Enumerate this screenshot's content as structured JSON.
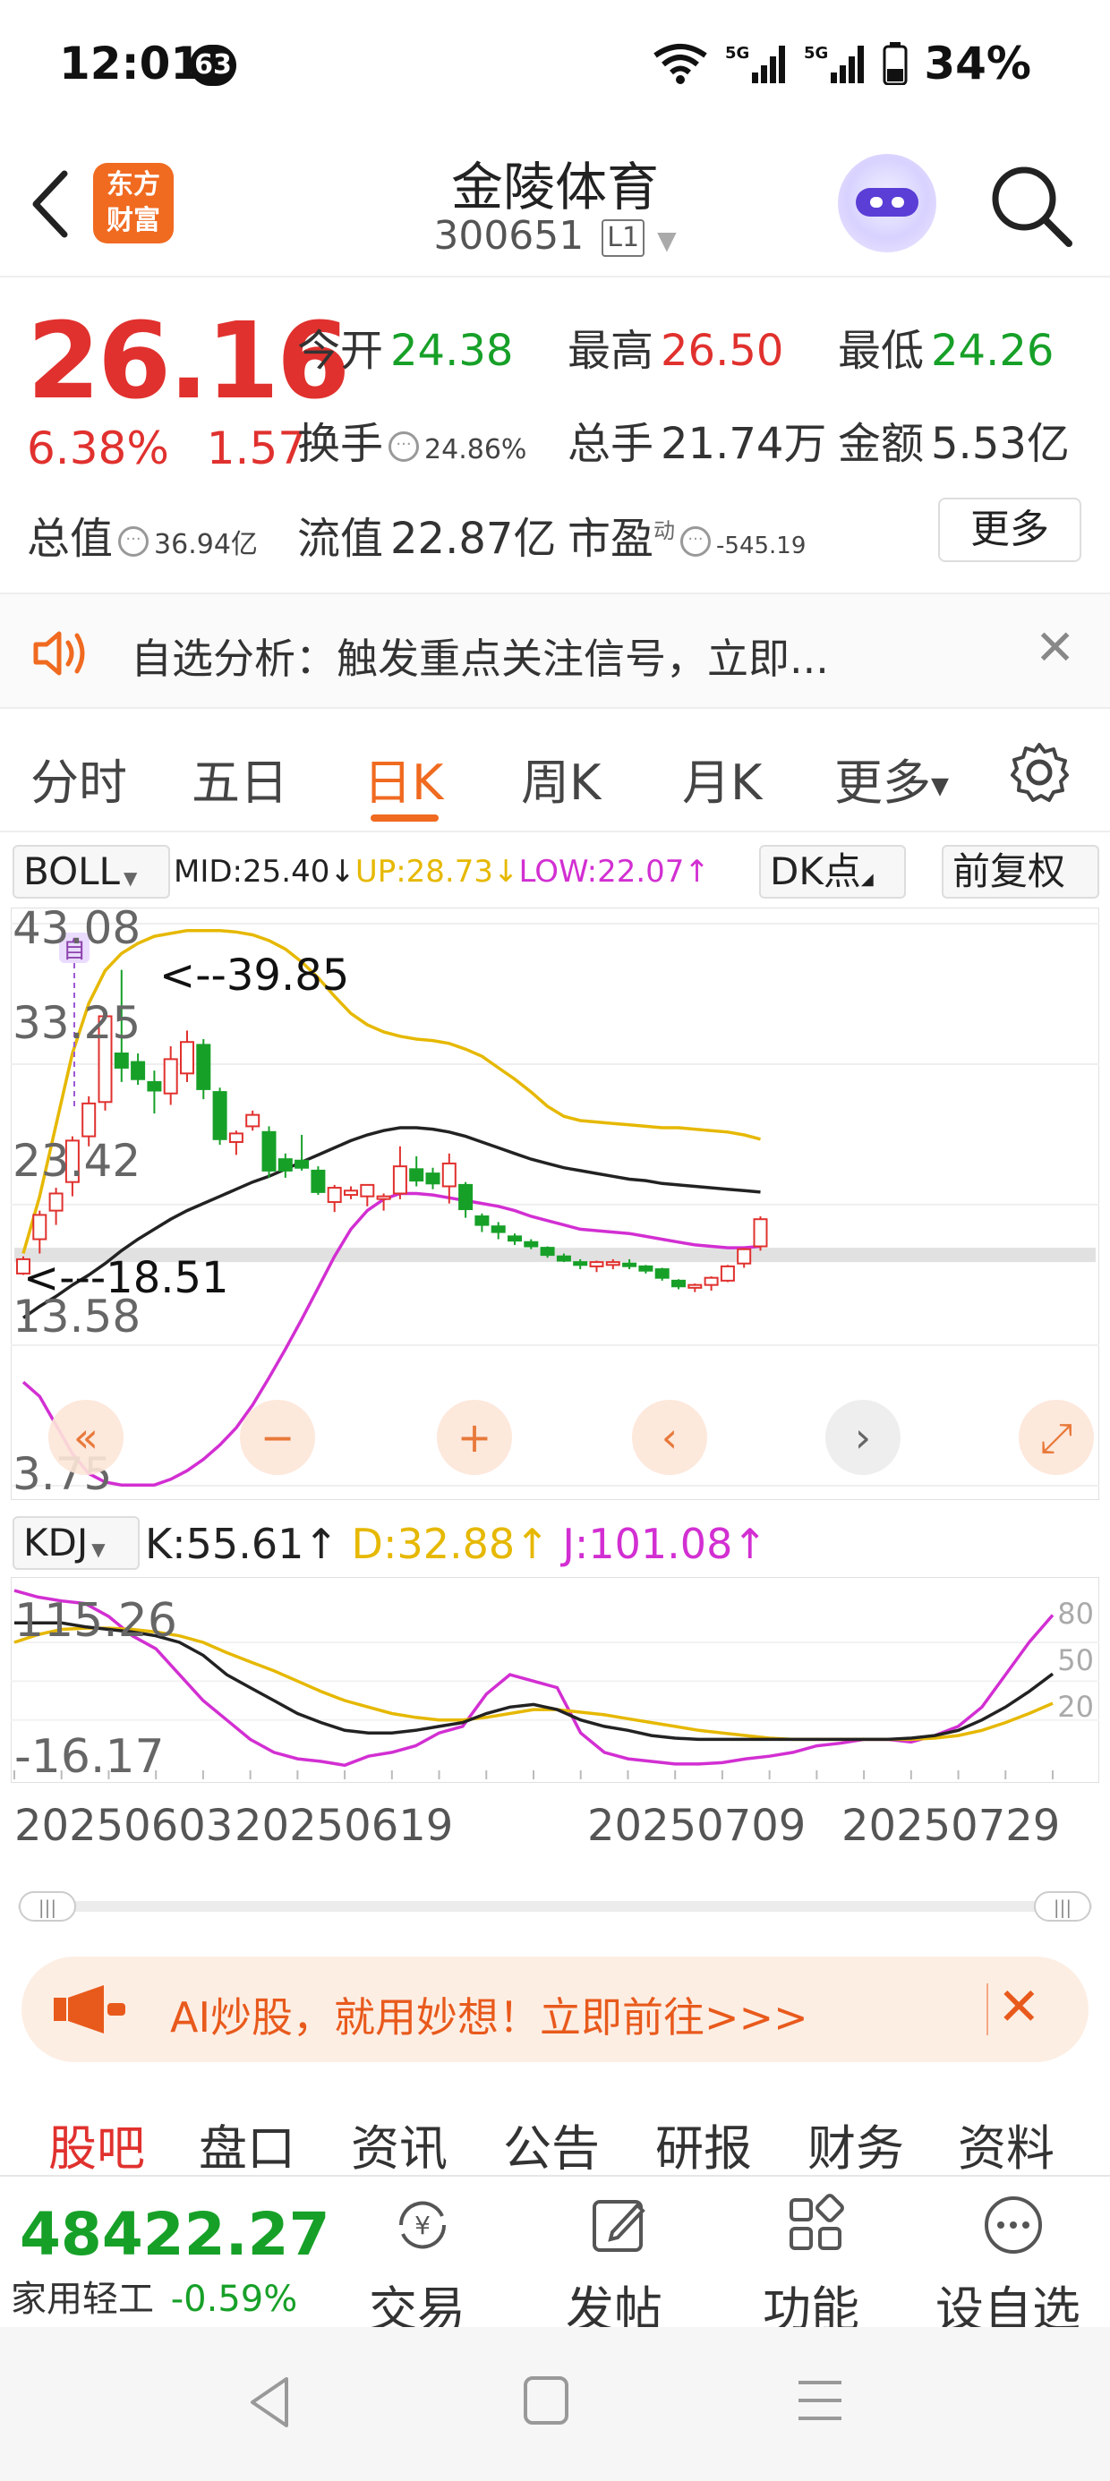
{
  "status_bar": {
    "time": "12:01",
    "notification_count": "63",
    "network": "5G",
    "battery": "34%"
  },
  "header": {
    "logo_line1": "东方",
    "logo_line2": "财富",
    "stock_name": "金陵体育",
    "stock_code": "300651",
    "level": "L1"
  },
  "quote": {
    "price": "26.16",
    "change_pct": "6.38%",
    "change_amt": "1.57",
    "open_label": "今开",
    "open": "24.38",
    "high_label": "最高",
    "high": "26.50",
    "low_label": "最低",
    "low": "24.26",
    "turnover_label": "换手",
    "turnover": "24.86%",
    "volume_label": "总手",
    "volume": "21.74万",
    "amount_label": "金额",
    "amount": "5.53亿",
    "mktcap_label": "总值",
    "mktcap": "36.94亿",
    "float_label": "流值",
    "float_cap": "22.87亿",
    "pe_label": "市盈",
    "pe_sup": "动",
    "pe": "-545.19",
    "more_button": "更多"
  },
  "banner": {
    "text": "自选分析：触发重点关注信号，立即..."
  },
  "period_tabs": {
    "items": [
      "分时",
      "五日",
      "日K",
      "周K",
      "月K",
      "更多"
    ],
    "active": "日K"
  },
  "boll": {
    "selector": "BOLL",
    "mid": "MID:25.40↓",
    "up": "UP:28.73↓",
    "low": "LOW:22.07↑",
    "dk_button": "DK点",
    "adjust_button": "前复权",
    "color_mid": "#222222",
    "color_up": "#e6b800",
    "color_low": "#d22fd2"
  },
  "chart_data": [
    {
      "type": "candlestick",
      "indicator": "BOLL",
      "y_axis_ticks": [
        "43.08",
        "33.25",
        "23.42",
        "13.58",
        "3.75"
      ],
      "ylim": [
        3.75,
        43.08
      ],
      "annotations": [
        "<--39.85",
        "<---18.51"
      ],
      "marker": "自",
      "candles": [
        {
          "o": 18.6,
          "h": 19.8,
          "l": 18.5,
          "c": 19.6
        },
        {
          "o": 21.0,
          "h": 23.0,
          "l": 20.0,
          "c": 22.7
        },
        {
          "o": 23.0,
          "h": 24.6,
          "l": 22.0,
          "c": 24.2
        },
        {
          "o": 25.0,
          "h": 28.2,
          "l": 24.0,
          "c": 27.9
        },
        {
          "o": 28.2,
          "h": 31.0,
          "l": 27.5,
          "c": 30.5
        },
        {
          "o": 30.6,
          "h": 36.8,
          "l": 30.0,
          "c": 36.6
        },
        {
          "o": 34.0,
          "h": 39.85,
          "l": 32.0,
          "c": 33.0
        },
        {
          "o": 33.4,
          "h": 34.0,
          "l": 31.8,
          "c": 32.2
        },
        {
          "o": 32.0,
          "h": 32.8,
          "l": 29.8,
          "c": 31.4
        },
        {
          "o": 31.2,
          "h": 34.5,
          "l": 30.4,
          "c": 33.6
        },
        {
          "o": 32.6,
          "h": 35.6,
          "l": 32.0,
          "c": 34.8
        },
        {
          "o": 34.6,
          "h": 35.0,
          "l": 30.8,
          "c": 31.5
        },
        {
          "o": 31.3,
          "h": 31.6,
          "l": 27.6,
          "c": 28.0
        },
        {
          "o": 27.8,
          "h": 28.6,
          "l": 26.9,
          "c": 28.4
        },
        {
          "o": 28.9,
          "h": 30.0,
          "l": 28.6,
          "c": 29.7
        },
        {
          "o": 28.5,
          "h": 28.9,
          "l": 25.3,
          "c": 25.8
        },
        {
          "o": 26.6,
          "h": 27.0,
          "l": 25.3,
          "c": 25.8
        },
        {
          "o": 26.5,
          "h": 28.3,
          "l": 25.8,
          "c": 26.0
        },
        {
          "o": 25.8,
          "h": 26.1,
          "l": 24.1,
          "c": 24.3
        },
        {
          "o": 23.6,
          "h": 24.8,
          "l": 22.9,
          "c": 24.6
        },
        {
          "o": 24.1,
          "h": 24.7,
          "l": 23.8,
          "c": 24.4
        },
        {
          "o": 24.0,
          "h": 24.8,
          "l": 23.3,
          "c": 24.8
        },
        {
          "o": 24.0,
          "h": 24.2,
          "l": 23.0,
          "c": 24.0
        },
        {
          "o": 24.2,
          "h": 27.5,
          "l": 23.8,
          "c": 26.1
        },
        {
          "o": 25.9,
          "h": 26.8,
          "l": 24.7,
          "c": 25.1
        },
        {
          "o": 25.6,
          "h": 26.0,
          "l": 24.5,
          "c": 24.9
        },
        {
          "o": 24.7,
          "h": 27.0,
          "l": 23.5,
          "c": 26.3
        },
        {
          "o": 24.8,
          "h": 25.0,
          "l": 22.5,
          "c": 23.1
        },
        {
          "o": 22.6,
          "h": 22.8,
          "l": 21.5,
          "c": 22.0
        },
        {
          "o": 21.9,
          "h": 22.2,
          "l": 21.0,
          "c": 21.5
        },
        {
          "o": 21.2,
          "h": 21.4,
          "l": 20.6,
          "c": 20.9
        },
        {
          "o": 20.8,
          "h": 21.0,
          "l": 20.3,
          "c": 20.5
        },
        {
          "o": 20.4,
          "h": 20.5,
          "l": 19.7,
          "c": 19.9
        },
        {
          "o": 19.8,
          "h": 20.0,
          "l": 19.4,
          "c": 19.5
        },
        {
          "o": 19.4,
          "h": 19.6,
          "l": 18.9,
          "c": 19.2
        },
        {
          "o": 19.1,
          "h": 19.5,
          "l": 18.7,
          "c": 19.4
        },
        {
          "o": 19.2,
          "h": 19.6,
          "l": 18.9,
          "c": 19.4
        },
        {
          "o": 19.3,
          "h": 19.6,
          "l": 18.9,
          "c": 19.2
        },
        {
          "o": 19.1,
          "h": 19.2,
          "l": 18.6,
          "c": 18.8
        },
        {
          "o": 18.9,
          "h": 19.0,
          "l": 18.1,
          "c": 18.3
        },
        {
          "o": 18.1,
          "h": 18.2,
          "l": 17.5,
          "c": 17.7
        },
        {
          "o": 17.6,
          "h": 17.9,
          "l": 17.3,
          "c": 17.8
        },
        {
          "o": 17.8,
          "h": 18.4,
          "l": 17.4,
          "c": 18.3
        },
        {
          "o": 18.1,
          "h": 19.2,
          "l": 18.0,
          "c": 19.1
        },
        {
          "o": 19.3,
          "h": 20.4,
          "l": 19.0,
          "c": 20.3
        },
        {
          "o": 20.5,
          "h": 22.6,
          "l": 20.2,
          "c": 22.4
        }
      ],
      "boll_up": [
        20.0,
        24.0,
        29.0,
        34.0,
        37.5,
        39.8,
        41.0,
        41.7,
        42.2,
        42.4,
        42.6,
        42.6,
        42.6,
        42.5,
        42.3,
        41.9,
        41.3,
        40.4,
        39.3,
        38.0,
        36.8,
        36.0,
        35.5,
        35.2,
        35.0,
        34.9,
        34.7,
        34.3,
        33.8,
        33.0,
        32.2,
        31.3,
        30.3,
        29.6,
        29.3,
        29.2,
        29.1,
        29.0,
        28.9,
        28.8,
        28.8,
        28.7,
        28.6,
        28.5,
        28.3,
        28.0
      ],
      "boll_mid": [
        15.5,
        16.3,
        17.0,
        17.8,
        18.5,
        19.3,
        20.2,
        21.0,
        21.7,
        22.4,
        23.0,
        23.5,
        24.0,
        24.5,
        25.0,
        25.4,
        25.9,
        26.4,
        26.9,
        27.4,
        27.9,
        28.3,
        28.6,
        28.8,
        28.8,
        28.7,
        28.5,
        28.2,
        27.8,
        27.4,
        27.0,
        26.6,
        26.3,
        26.0,
        25.8,
        25.6,
        25.4,
        25.2,
        25.1,
        24.9,
        24.8,
        24.7,
        24.6,
        24.5,
        24.4,
        24.3
      ],
      "boll_low": [
        11.0,
        10.0,
        8.0,
        6.0,
        4.6,
        4.0,
        3.8,
        3.8,
        3.8,
        4.2,
        4.8,
        5.6,
        6.6,
        7.8,
        9.4,
        11.3,
        13.3,
        15.4,
        17.6,
        19.8,
        21.7,
        23.0,
        23.8,
        24.2,
        24.2,
        24.1,
        23.9,
        23.7,
        23.5,
        23.3,
        23.0,
        22.6,
        22.3,
        22.0,
        21.7,
        21.6,
        21.5,
        21.4,
        21.2,
        21.0,
        20.8,
        20.6,
        20.5,
        20.4,
        20.4,
        20.5
      ]
    },
    {
      "type": "line",
      "indicator": "KDJ",
      "y_axis_ticks": [
        "115.26",
        "-16.17"
      ],
      "right_ticks": [
        "80",
        "50",
        "20"
      ],
      "x_tick_labels": [
        "20250603",
        "20250619",
        "20250709",
        "20250729"
      ],
      "series": [
        {
          "name": "K",
          "color": "#222222",
          "values": [
            95,
            95,
            95,
            92,
            90,
            88,
            85,
            80,
            70,
            55,
            45,
            35,
            25,
            18,
            12,
            10,
            10,
            12,
            15,
            18,
            25,
            30,
            32,
            28,
            20,
            15,
            12,
            8,
            6,
            5,
            5,
            5,
            5,
            5,
            5,
            5,
            5,
            5,
            6,
            8,
            12,
            20,
            30,
            42,
            55.61
          ]
        },
        {
          "name": "D",
          "color": "#e6b800",
          "values": [
            80,
            86,
            90,
            91,
            91,
            90,
            88,
            85,
            80,
            72,
            65,
            58,
            50,
            42,
            35,
            30,
            25,
            22,
            20,
            20,
            22,
            25,
            28,
            28,
            26,
            24,
            21,
            18,
            15,
            12,
            10,
            8,
            6,
            5,
            5,
            5,
            5,
            5,
            5,
            6,
            8,
            12,
            18,
            25,
            32.88
          ]
        },
        {
          "name": "J",
          "color": "#d22fd2",
          "values": [
            120,
            115,
            112,
            110,
            100,
            85,
            75,
            55,
            35,
            20,
            5,
            -5,
            -10,
            -12,
            -15,
            -8,
            -5,
            0,
            10,
            15,
            40,
            55,
            50,
            45,
            10,
            -5,
            -10,
            -12,
            -14,
            -14,
            -13,
            -10,
            -8,
            -5,
            0,
            2,
            5,
            5,
            3,
            8,
            15,
            30,
            55,
            80,
            101.08
          ]
        }
      ]
    }
  ],
  "chart_controls": {
    "items": [
      "first-page",
      "zoom-out",
      "zoom-in",
      "prev",
      "next",
      "expand"
    ]
  },
  "kdj": {
    "selector": "KDJ",
    "k": "K:55.61↑",
    "d": "D:32.88↑",
    "j": "J:101.08↑"
  },
  "ai_banner": {
    "text": "AI炒股，就用妙想！立即前往>>>",
    "close": "✕"
  },
  "section_tabs": {
    "items": [
      "股吧",
      "盘口",
      "资讯",
      "公告",
      "研报",
      "财务",
      "资料"
    ],
    "active": "股吧"
  },
  "toolbar": {
    "index_value": "48422.27",
    "index_name": "家用轻工",
    "index_change": "-0.59%",
    "items": [
      "交易",
      "发帖",
      "功能",
      "设自选"
    ]
  }
}
